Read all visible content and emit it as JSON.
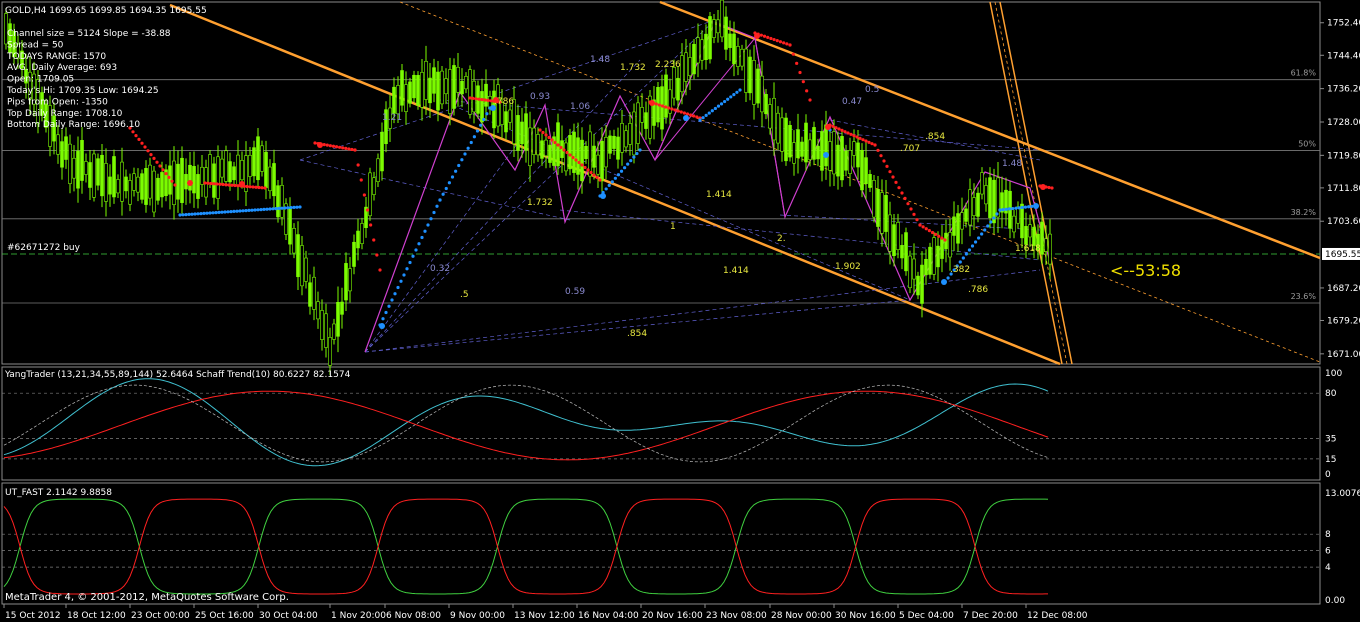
{
  "main_chart": {
    "title": "GOLD,H4  1699.65 1699.85 1694.35 1695.55",
    "info_lines": [
      "Channel size = 5124 Slope = -38.88",
      "Spread = 50",
      "TODAYS RANGE: 1570",
      "AVG. Daily Average: 693",
      "Open: 1709.05",
      "Today's Hi: 1709.35  Low: 1694.25",
      "Pips from Open: -1350",
      "Top Daily Range: 1708.10",
      "Bottom Daily Range: 1696.10"
    ],
    "order_label": "#62671272 buy",
    "countdown": "<--53:58",
    "current_price": "1695.55",
    "price_ticks": [
      "1752.40",
      "1744.40",
      "1736.20",
      "1728.00",
      "1719.80",
      "1711.80",
      "1703.60",
      "1695.55",
      "1687.20",
      "1679.20",
      "1671.00"
    ],
    "fib_levels": [
      "61.8%",
      "50%",
      "38.2%",
      "23.6%"
    ],
    "ratio_labels": [
      {
        "text": "1.48",
        "color": "#8a8acf"
      },
      {
        "text": "1.732",
        "color": "#e8e840"
      },
      {
        "text": "2.236",
        "color": "#e8e840"
      },
      {
        "text": "1.21",
        "color": "#8a8acf"
      },
      {
        "text": ".786",
        "color": "#e8e840"
      },
      {
        "text": "0.93",
        "color": "#8a8acf"
      },
      {
        "text": "1.06",
        "color": "#8a8acf"
      },
      {
        "text": "0.5",
        "color": "#8a8acf"
      },
      {
        "text": "0.47",
        "color": "#8a8acf"
      },
      {
        "text": ".854",
        "color": "#e8e840"
      },
      {
        "text": ".707",
        "color": "#e8e840"
      },
      {
        "text": "1.48",
        "color": "#8a8acf"
      },
      {
        "text": "1.732",
        "color": "#e8e840"
      },
      {
        "text": "1.414",
        "color": "#e8e840"
      },
      {
        "text": "1",
        "color": "#e8e840"
      },
      {
        "text": "2.",
        "color": "#e8e840"
      },
      {
        "text": "1.618",
        "color": "#e8e840"
      },
      {
        "text": "0.32",
        "color": "#8a8acf"
      },
      {
        "text": ".5",
        "color": "#e8e840"
      },
      {
        "text": "1.414",
        "color": "#e8e840"
      },
      {
        "text": "1.902",
        "color": "#e8e840"
      },
      {
        "text": ".382",
        "color": "#e8e840"
      },
      {
        "text": "0.59",
        "color": "#8a8acf"
      },
      {
        "text": ".786",
        "color": "#e8e840"
      },
      {
        "text": ".854",
        "color": "#e8e840"
      }
    ]
  },
  "indicator1": {
    "title": "YangTrader (13,21,34,55,89,144) 52.6464  Schaff Trend(10) 80.6227 82.1574",
    "ticks": [
      "100",
      "80",
      "35",
      "15",
      "0"
    ]
  },
  "indicator2": {
    "title": "UT_FAST 2.1142 9.8858",
    "ticks": [
      "13.0076",
      "8",
      "6",
      "4",
      "0.00"
    ]
  },
  "time_ticks": [
    "15 Oct 2012",
    "18 Oct 12:00",
    "23 Oct 00:00",
    "25 Oct 16:00",
    "30 Oct 04:00",
    "1 Nov 20:00",
    "6 Nov 08:00",
    "9 Nov 00:00",
    "13 Nov 12:00",
    "16 Nov 04:00",
    "20 Nov 16:00",
    "23 Nov 08:00",
    "28 Nov 00:00",
    "30 Nov 16:00",
    "5 Dec 04:00",
    "7 Dec 20:00",
    "12 Dec 08:00"
  ],
  "copyright": "MetaTrader 4, © 2001-2012, MetaQuotes Software Corp.",
  "colors": {
    "candle": "#7CFC00",
    "up_dots": "#1E90FF",
    "down_dots": "#FF2020",
    "channel": "#FFA030",
    "zigzag": "#D040D0",
    "fib": "#6060D0",
    "grid": "#A0A0A0",
    "schaff_red": "#FF2020",
    "schaff_cyan": "#40C0D0",
    "ut_green": "#40D040",
    "ut_red": "#FF2020"
  },
  "chart_data": {
    "type": "line",
    "title": "GOLD,H4",
    "x": [
      "15 Oct 2012",
      "18 Oct 12:00",
      "23 Oct 00:00",
      "25 Oct 16:00",
      "30 Oct 04:00",
      "1 Nov 20:00",
      "6 Nov 08:00",
      "9 Nov 00:00",
      "13 Nov 12:00",
      "16 Nov 04:00",
      "20 Nov 16:00",
      "23 Nov 08:00",
      "28 Nov 00:00",
      "30 Nov 16:00",
      "5 Dec 04:00",
      "7 Dec 20:00",
      "12 Dec 08:00"
    ],
    "series": [
      {
        "values": [
          1752,
          1718,
          1712,
          1714,
          1718,
          1673,
          1735,
          1738,
          1724,
          1718,
          1731,
          1752,
          1722,
          1720,
          1688,
          1712,
          1695.55
        ]
      }
    ],
    "ylim": [
      1668,
      1758
    ]
  }
}
